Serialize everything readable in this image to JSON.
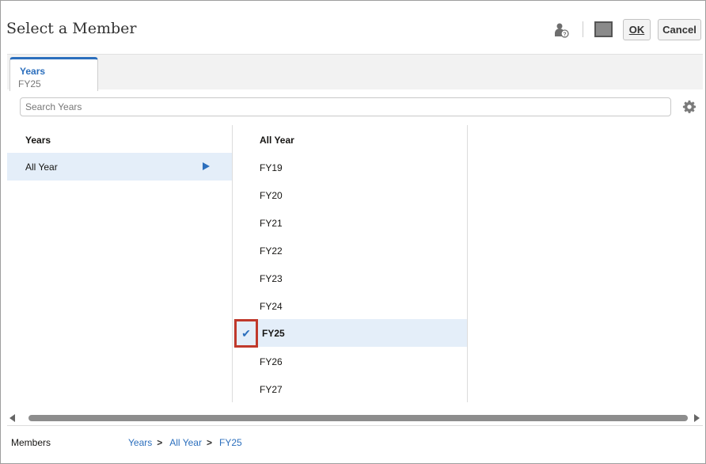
{
  "dialog": {
    "title": "Select a Member",
    "ok_label": "OK",
    "cancel_label": "Cancel",
    "swatch_color": "#8a8a8a",
    "user_icon": "user-help-icon"
  },
  "tab": {
    "title": "Years",
    "value": "FY25"
  },
  "search": {
    "placeholder": "Search Years"
  },
  "columns": {
    "left": {
      "header": "Years",
      "items": [
        {
          "label": "All Year",
          "selected": true
        }
      ]
    },
    "middle": {
      "header": "All Year",
      "items": [
        {
          "label": "FY19"
        },
        {
          "label": "FY20"
        },
        {
          "label": "FY21"
        },
        {
          "label": "FY22"
        },
        {
          "label": "FY23"
        },
        {
          "label": "FY24"
        },
        {
          "label": "FY25",
          "checked": true
        },
        {
          "label": "FY26"
        },
        {
          "label": "FY27"
        }
      ]
    }
  },
  "footer": {
    "label": "Members",
    "breadcrumb": [
      "Years",
      "All Year",
      "FY25"
    ],
    "separator": ">"
  },
  "colors": {
    "accent": "#2c6fbd",
    "selected_bg": "#e4eef9",
    "highlight": "#c0392b"
  }
}
